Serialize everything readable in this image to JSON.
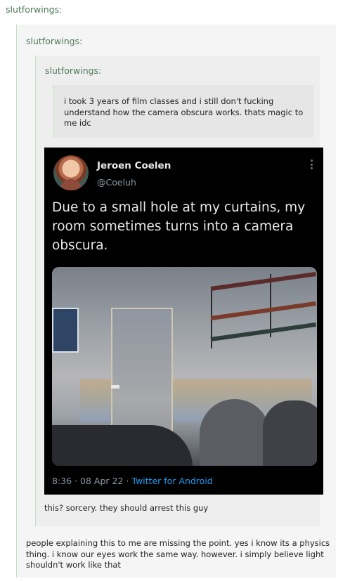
{
  "thread": {
    "top_username": "slutforwings:",
    "level1_username": "slutforwings:",
    "level2_username": "slutforwings:",
    "level3_text": "i took 3 years of film classes and i still don't fucking understand how the camera obscura works. thats magic to me idc",
    "reply_text": "this? sorcery. they should arrest this guy",
    "final_text": "people explaining this to me are missing the point. yes i know its a physics thing. i know our eyes work the same way. however. i simply believe light shouldn't work like that"
  },
  "tweet": {
    "name": "Jeroen Coelen",
    "handle": "@Coeluh",
    "body": "Due to a small hole at my curtains, my room sometimes turns into a camera obscura.",
    "time": "8:36",
    "date": "08 Apr 22",
    "source": "Twitter for Android",
    "separator": "·",
    "icons": {
      "more": "more-vertical-icon"
    },
    "colors": {
      "background": "#000000",
      "link": "#1d9bf0",
      "muted": "#8b98a5",
      "text": "#e7e9ea"
    }
  },
  "colors": {
    "username": "#4e7a5a",
    "quote_border": "#c6dcc6"
  }
}
